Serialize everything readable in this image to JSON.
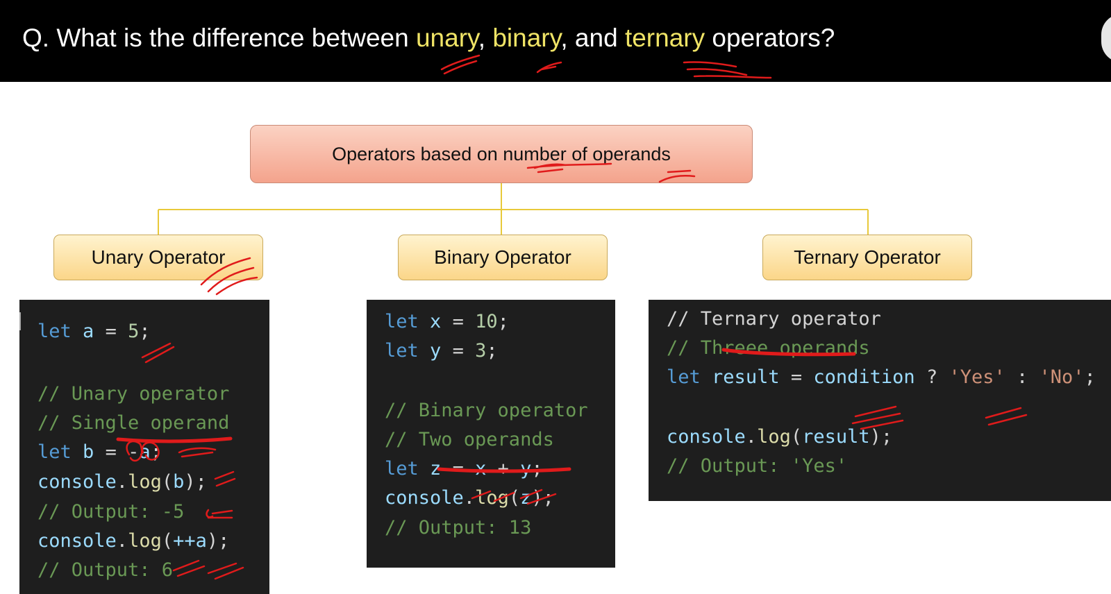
{
  "header": {
    "q_prefix": "Q. What is the difference between ",
    "word_unary": "unary",
    "sep1": ", ",
    "word_binary": "binary",
    "sep2": ", and ",
    "word_ternary": "ternary",
    "q_suffix": " operators?"
  },
  "diagram": {
    "root": "Operators based on number of operands",
    "children": [
      "Unary Operator",
      "Binary Operator",
      "Ternary Operator"
    ]
  },
  "code": {
    "unary": {
      "l1": {
        "kw": "let",
        "var": "a",
        "eq": " = ",
        "num": "5",
        "end": ";"
      },
      "c1": "// Unary operator",
      "c2": "// Single operand",
      "l2": {
        "kw": "let",
        "var": "b",
        "eq": " = ",
        "op": "-",
        "var2": "a",
        "end": ";"
      },
      "l3": {
        "obj": "console",
        "dot": ".",
        "fn": "log",
        "open": "(",
        "arg": "b",
        "close": ");"
      },
      "c3": "// Output: -5",
      "l4": {
        "obj": "console",
        "dot": ".",
        "fn": "log",
        "open": "(",
        "arg": "++a",
        "close": ");"
      },
      "c4": "// Output: 6"
    },
    "binary": {
      "l1": {
        "kw": "let",
        "var": "x",
        "eq": " = ",
        "num": "10",
        "end": ";"
      },
      "l2": {
        "kw": "let",
        "var": "y",
        "eq": " = ",
        "num": "3",
        "end": ";"
      },
      "c1": "// Binary operator",
      "c2": "// Two operands",
      "l3": {
        "kw": "let",
        "var": "z",
        "eq": " = ",
        "a": "x",
        "op": " + ",
        "b": "y",
        "end": ";"
      },
      "l4": {
        "obj": "console",
        "dot": ".",
        "fn": "log",
        "open": "(",
        "arg": "z",
        "close": ");"
      },
      "c3": "// Output: 13"
    },
    "ternary": {
      "c1": "// Ternary operator",
      "c2": "// Threee operands",
      "l1": {
        "kw": "let",
        "var": "result",
        "eq": " = ",
        "cond": "condition",
        "q": " ? ",
        "yes": "'Yes'",
        "colon": " : ",
        "no": "'No'",
        "end": ";"
      },
      "l2": {
        "obj": "console",
        "dot": ".",
        "fn": "log",
        "open": "(",
        "arg": "result",
        "close": ");"
      },
      "c3": "// Output: 'Yes'"
    }
  },
  "colors": {
    "header_bg": "#000000",
    "highlight": "#f0e466",
    "root_fill": "#f4a38c",
    "child_fill": "#fbd689",
    "connector": "#e8c93a",
    "code_bg": "#1e1e1e",
    "annotation": "#e01b1b"
  }
}
